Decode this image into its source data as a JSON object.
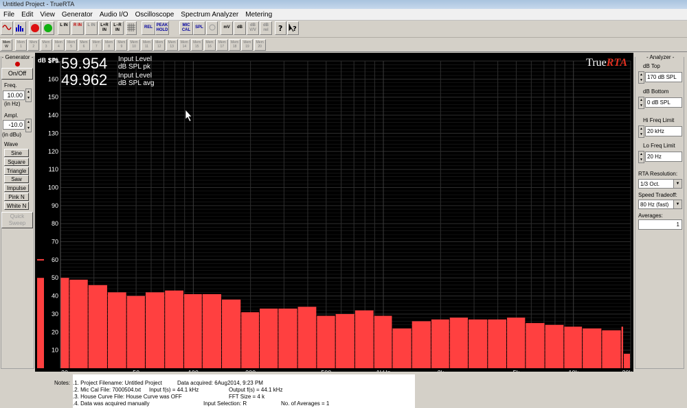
{
  "window": {
    "title": "Untitled Project - TrueRTA"
  },
  "menu": [
    "File",
    "Edit",
    "View",
    "Generator",
    "Audio I/O",
    "Oscilloscope",
    "Spectrum Analyzer",
    "Metering"
  ],
  "toolbar": {
    "buttons": [
      "L IN",
      "R IN",
      "L IN",
      "L+R IN",
      "L−R IN",
      "REL",
      "PEAK HOLD",
      "MIC CAL",
      "SPL",
      "mV",
      "dB",
      "dB V/V",
      "dB rel"
    ],
    "memory_label": "Mem",
    "memory_first": "W",
    "memory_slots": [
      "1",
      "2",
      "3",
      "4",
      "5",
      "6",
      "7",
      "8",
      "9",
      "10",
      "11",
      "12",
      "13",
      "14",
      "15",
      "16",
      "17",
      "18",
      "19",
      "20"
    ]
  },
  "generator": {
    "title": "- Generator -",
    "onoff_label": "On/Off",
    "freq_label": "Freq.",
    "freq_value": "10.00",
    "freq_unit": "(in Hz)",
    "ampl_label": "Ampl.",
    "ampl_value": "-10.0",
    "ampl_unit": "(in dBu)",
    "wave_label": "Wave",
    "waves": [
      "Sine",
      "Square",
      "Triangle",
      "Saw",
      "Impulse",
      "Pink N",
      "White N"
    ],
    "quick_sweep_label": "Quick Sweep",
    "led_color": "#cc0000"
  },
  "display": {
    "readout1_value": "59.954",
    "readout1_label1": "Input Level",
    "readout1_label2": "dB SPL pk",
    "readout2_value": "49.962",
    "readout2_label1": "Input Level",
    "readout2_label2": "dB SPL avg",
    "logo_a": "True",
    "logo_b": "RTA"
  },
  "analyzer": {
    "title": "- Analyzer -",
    "db_top_label": "dB Top",
    "db_top_value": "170 dB SPL",
    "db_bottom_label": "dB Bottom",
    "db_bottom_value": "0 dB SPL",
    "hi_freq_label": "Hi Freq Limit",
    "hi_freq_value": "20 kHz",
    "lo_freq_label": "Lo Freq Limit",
    "lo_freq_value": "20 Hz",
    "resolution_label": "RTA Resolution:",
    "resolution_value": "1/3 Oct.",
    "speed_label": "Speed Tradeoff:",
    "speed_value": "80 Hz (fast)",
    "averages_label": "Averages:",
    "averages_value": "1"
  },
  "notes": {
    "label": "Notes:",
    "line1a": ".1. Project Filename: Untitled Project",
    "line1b": "Data acquired: 6Aug2014, 9:23 PM",
    "line2a": ".2. Mic Cal File: 7000504.txt",
    "line2b": "Input f(s) = 44.1 kHz",
    "line2c": "Output f(s) = 44.1 kHz",
    "line3a": ".3. House Curve File: House Curve was OFF",
    "line3b": "FFT Size = 4 k",
    "line4a": ".4. Data was acquired manually",
    "line4b": "Input Selection: R",
    "line4c": "No. of Averages = 1"
  },
  "colors": {
    "bar": "#ff4040",
    "plot_bg": "#000000",
    "grid": "#2e2e2e",
    "logo_accent": "#e03020"
  },
  "chart_data": {
    "type": "bar",
    "ylabel": "dB SPL",
    "ylim": [
      0,
      170
    ],
    "x_scale": "log",
    "xlim": [
      20,
      20000
    ],
    "y_ticks": [
      10,
      20,
      30,
      40,
      50,
      60,
      70,
      80,
      90,
      100,
      110,
      120,
      130,
      140,
      150,
      160,
      170
    ],
    "x_ticks": [
      {
        "v": 20,
        "label": "20"
      },
      {
        "v": 50,
        "label": "50"
      },
      {
        "v": 100,
        "label": "100"
      },
      {
        "v": 200,
        "label": "200"
      },
      {
        "v": 500,
        "label": "500"
      },
      {
        "v": 1000,
        "label": "1kHz"
      },
      {
        "v": 2000,
        "label": "2k"
      },
      {
        "v": 5000,
        "label": "5k"
      },
      {
        "v": 10000,
        "label": "10k"
      },
      {
        "v": 20000,
        "label": "20k"
      }
    ],
    "categories": [
      20,
      25,
      31.5,
      40,
      50,
      63,
      80,
      100,
      125,
      160,
      200,
      250,
      315,
      400,
      500,
      630,
      800,
      1000,
      1250,
      1600,
      2000,
      2500,
      3150,
      4000,
      5000,
      6300,
      8000,
      10000,
      12500,
      16000,
      20000
    ],
    "values": [
      50,
      49,
      46,
      42,
      40,
      42,
      43,
      41,
      41,
      38,
      31,
      33,
      33,
      34,
      29,
      30,
      32,
      29,
      22,
      26,
      27,
      28,
      27,
      27,
      28,
      25,
      24,
      23,
      22,
      21,
      23,
      8
    ],
    "level_meter": {
      "value": 50,
      "peak": 60
    }
  }
}
